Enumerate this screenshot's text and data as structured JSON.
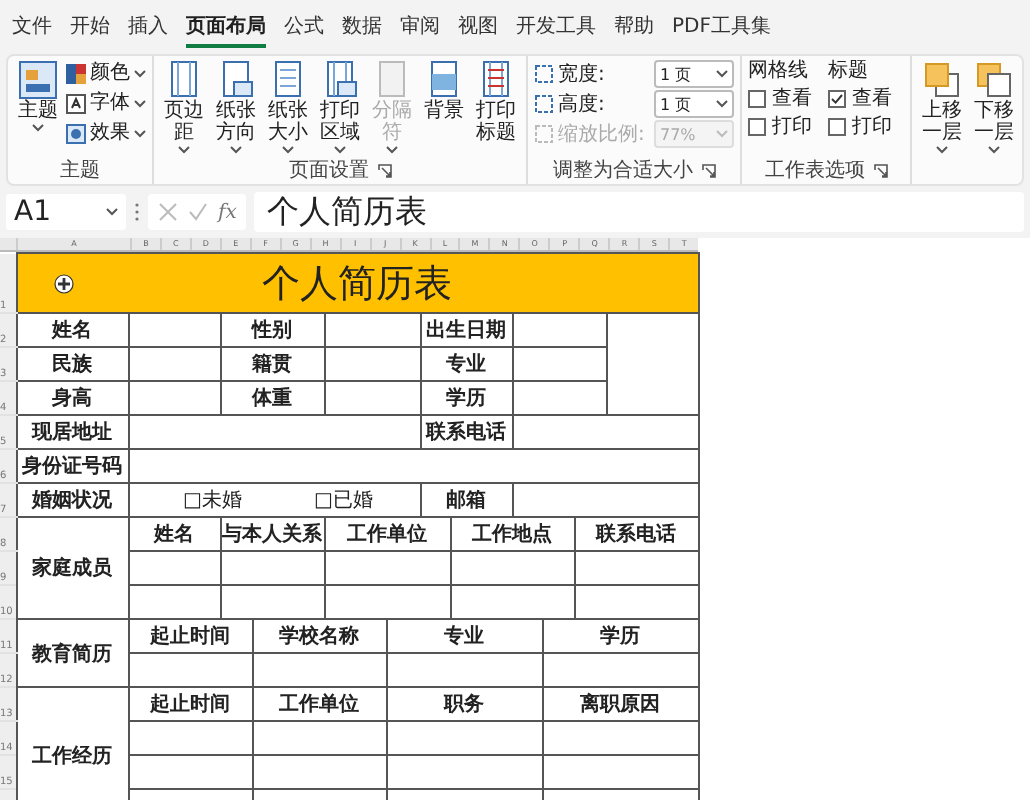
{
  "ribbon_tabs": [
    {
      "label": "文件",
      "selected": false
    },
    {
      "label": "开始",
      "selected": false
    },
    {
      "label": "插入",
      "selected": false
    },
    {
      "label": "页面布局",
      "selected": true
    },
    {
      "label": "公式",
      "selected": false
    },
    {
      "label": "数据",
      "selected": false
    },
    {
      "label": "审阅",
      "selected": false
    },
    {
      "label": "视图",
      "selected": false
    },
    {
      "label": "开发工具",
      "selected": false
    },
    {
      "label": "帮助",
      "selected": false
    },
    {
      "label": "PDF工具集",
      "selected": false
    }
  ],
  "theme_group": {
    "label": "主题",
    "big_button": "主题",
    "items": [
      "颜色",
      "字体",
      "效果"
    ]
  },
  "page_setup_group": {
    "label": "页面设置",
    "buttons": [
      {
        "label": "页边距",
        "disabled": false
      },
      {
        "label": "纸张方向",
        "disabled": false
      },
      {
        "label": "纸张大小",
        "disabled": false
      },
      {
        "label": "打印区域",
        "disabled": false
      },
      {
        "label": "分隔符",
        "disabled": true
      },
      {
        "label": "背景",
        "disabled": false
      },
      {
        "label": "打印标题",
        "disabled": false
      }
    ]
  },
  "scale_group": {
    "label": "调整为合适大小",
    "fields": [
      {
        "label": "宽度:",
        "value": "1 页",
        "disabled": false
      },
      {
        "label": "高度:",
        "value": "1 页",
        "disabled": false
      },
      {
        "label": "缩放比例:",
        "value": "77%",
        "disabled": true
      }
    ]
  },
  "sheet_options_group": {
    "label": "工作表选项",
    "columns": [
      {
        "title": "网格线",
        "options": [
          {
            "label": "查看",
            "checked": false
          },
          {
            "label": "打印",
            "checked": false
          }
        ]
      },
      {
        "title": "标题",
        "options": [
          {
            "label": "查看",
            "checked": true
          },
          {
            "label": "打印",
            "checked": false
          }
        ]
      }
    ]
  },
  "arrange_group": {
    "buttons": [
      "上移一层",
      "下移一层"
    ]
  },
  "formula_bar": {
    "name_box": "A1",
    "fx_label": "fx",
    "formula": "个人简历表"
  },
  "sheet": {
    "column_headers": [
      "A",
      "B",
      "C",
      "D",
      "E",
      "F",
      "G",
      "H",
      "I",
      "J",
      "K",
      "L",
      "M",
      "N",
      "O",
      "P",
      "Q",
      "R",
      "S",
      "T"
    ],
    "row_numbers": [
      "1",
      "2",
      "3",
      "4",
      "5",
      "6",
      "7",
      "8",
      "9",
      "10",
      "11",
      "12",
      "13",
      "14",
      "15"
    ],
    "title": "个人简历表",
    "basic_info": [
      [
        "姓名",
        "性别",
        "出生日期"
      ],
      [
        "民族",
        "籍贯",
        "专业"
      ],
      [
        "身高",
        "体重",
        "学历"
      ]
    ],
    "address": {
      "label": "现居地址",
      "phone_label": "联系电话"
    },
    "id_label": "身份证号码",
    "marital": {
      "label": "婚姻状况",
      "options": [
        "□未婚",
        "□已婚"
      ],
      "email_label": "邮箱"
    },
    "family": {
      "label": "家庭成员",
      "columns": [
        "姓名",
        "与本人关系",
        "工作单位",
        "工作地点",
        "联系电话"
      ]
    },
    "education": {
      "label": "教育简历",
      "columns": [
        "起止时间",
        "学校名称",
        "专业",
        "学历"
      ]
    },
    "work": {
      "label": "工作经历",
      "columns": [
        "起止时间",
        "工作单位",
        "职务",
        "离职原因"
      ]
    }
  }
}
